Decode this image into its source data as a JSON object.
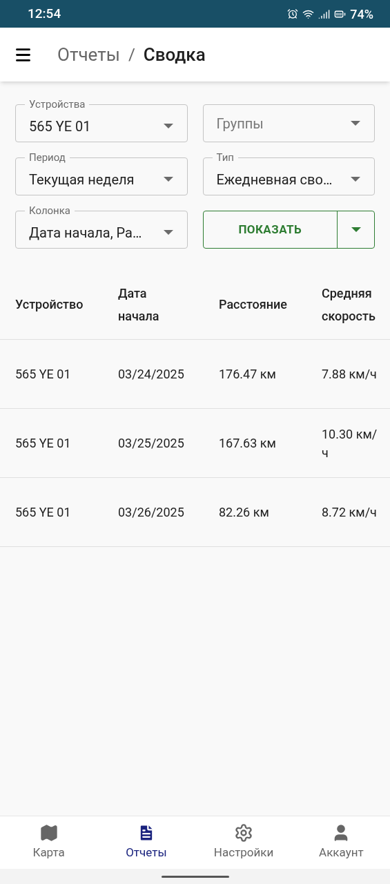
{
  "status_bar": {
    "time": "12:54",
    "battery": "74%"
  },
  "app_bar": {
    "breadcrumb_parent": "Отчеты",
    "separator": "/",
    "title": "Сводка"
  },
  "filters": [
    {
      "kind": "select",
      "label": "Устройства",
      "value": "565 YE 01"
    },
    {
      "kind": "select",
      "placeholder": "Группы"
    },
    {
      "kind": "select",
      "label": "Период",
      "value": "Текущая неделя"
    },
    {
      "kind": "select",
      "label": "Тип",
      "value": "Ежедневная сво…"
    },
    {
      "kind": "select",
      "label": "Колонка",
      "value": "Дата начала, Ра…"
    },
    {
      "kind": "split_button",
      "label": "ПОКАЗАТЬ"
    }
  ],
  "table": {
    "columns": [
      "Устройство",
      "Дата начала",
      "Расстояние",
      "Средняя скорость"
    ],
    "rows": [
      [
        "565 YE 01",
        "03/24/2025",
        "176.47 км",
        "7.88 км/ч"
      ],
      [
        "565 YE 01",
        "03/25/2025",
        "167.63 км",
        "10.30 км/ч"
      ],
      [
        "565 YE 01",
        "03/26/2025",
        "82.26 км",
        "8.72 км/ч"
      ]
    ]
  },
  "bottom_nav": [
    {
      "kind": "map",
      "label": "Карта",
      "selected": false
    },
    {
      "kind": "report",
      "label": "Отчеты",
      "selected": true
    },
    {
      "kind": "settings",
      "label": "Настройки",
      "selected": false
    },
    {
      "kind": "account",
      "label": "Аккаунт",
      "selected": false
    }
  ]
}
